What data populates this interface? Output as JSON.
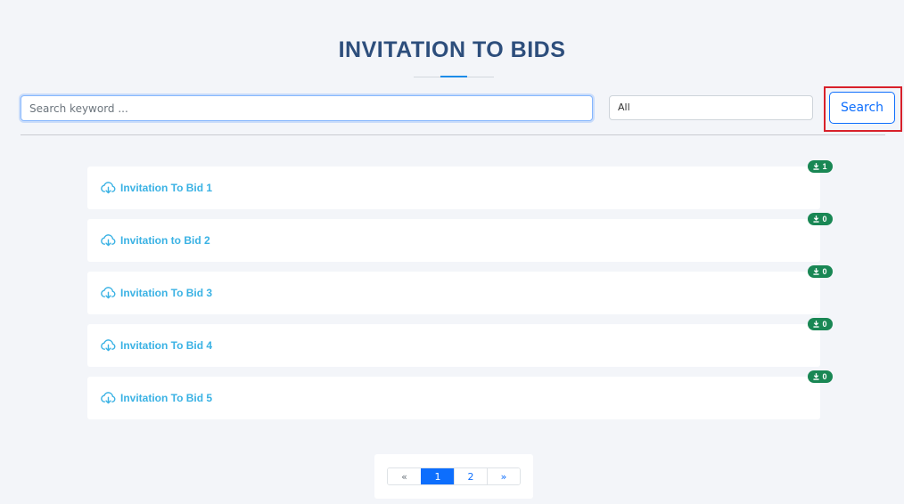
{
  "page": {
    "title": "INVITATION TO BIDS"
  },
  "search": {
    "placeholder": "Search keyword ...",
    "value": ""
  },
  "filter": {
    "selected": "All"
  },
  "search_button": {
    "label": "Search"
  },
  "bids": [
    {
      "title": "Invitation To Bid 1",
      "downloads": "1"
    },
    {
      "title": "Invitation to Bid 2",
      "downloads": "0"
    },
    {
      "title": "Invitation To Bid 3",
      "downloads": "0"
    },
    {
      "title": "Invitation To Bid 4",
      "downloads": "0"
    },
    {
      "title": "Invitation To Bid 5",
      "downloads": "0"
    }
  ],
  "pagination": {
    "prev": "«",
    "pages": [
      "1",
      "2"
    ],
    "current": "1",
    "next": "»"
  },
  "colors": {
    "accent": "#0d6efd",
    "title": "#2d4e7c",
    "link": "#3ab2e4",
    "badge": "#198754",
    "highlight": "#d8202a"
  },
  "icons": {
    "bid": "cloud-download-icon",
    "badge": "download-icon"
  }
}
